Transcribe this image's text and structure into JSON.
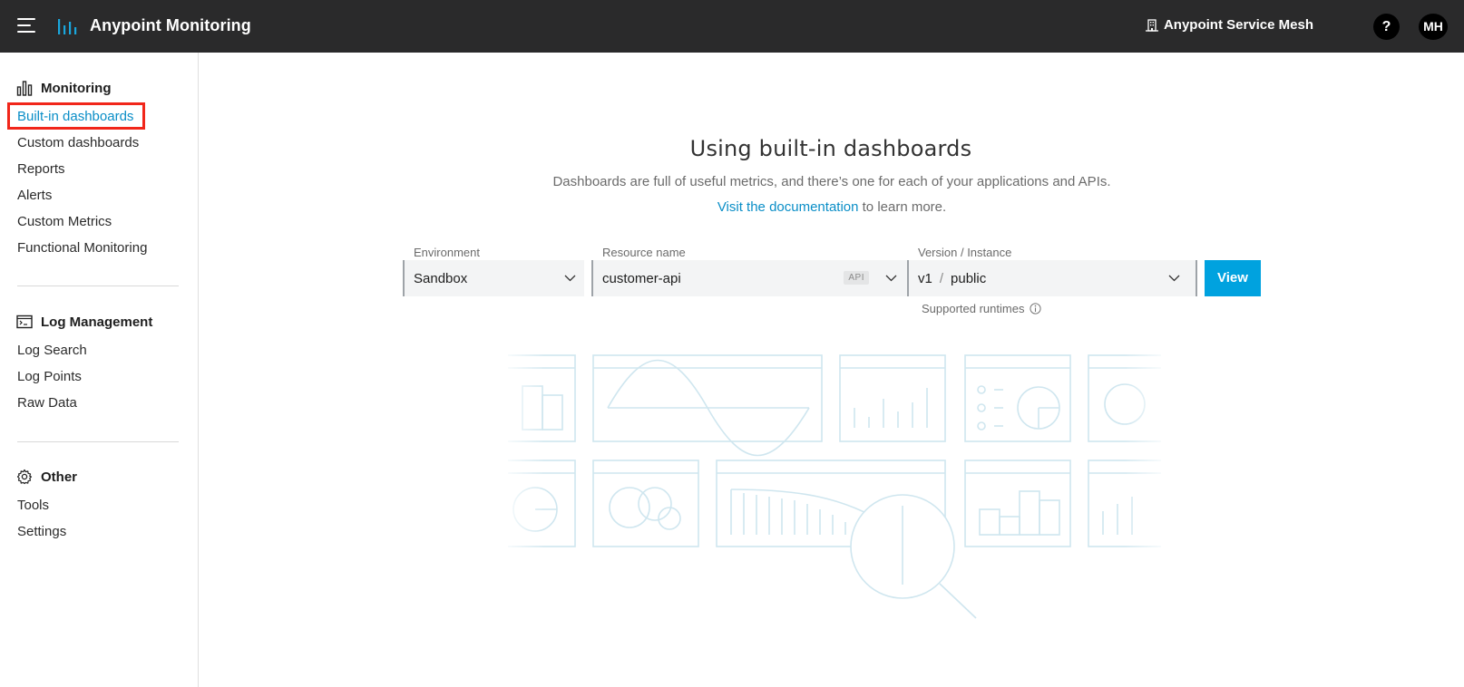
{
  "topbar": {
    "app_title": "Anypoint Monitoring",
    "mesh_label": "Anypoint Service Mesh",
    "help_label": "?",
    "avatar_initials": "MH",
    "menu_icon": "hamburger-menu-icon",
    "logo_icon": "bar-chart-logo-icon",
    "mesh_icon": "building-icon"
  },
  "sidebar": {
    "sections": [
      {
        "title": "Monitoring",
        "icon": "bar-chart-icon",
        "items": [
          "Built-in dashboards",
          "Custom dashboards",
          "Reports",
          "Alerts",
          "Custom Metrics",
          "Functional Monitoring"
        ]
      },
      {
        "title": "Log Management",
        "icon": "terminal-icon",
        "items": [
          "Log Search",
          "Log Points",
          "Raw Data"
        ]
      },
      {
        "title": "Other",
        "icon": "gear-icon",
        "items": [
          "Tools",
          "Settings"
        ]
      }
    ],
    "active_item": "Built-in dashboards"
  },
  "main": {
    "title": "Using built-in dashboards",
    "description": "Dashboards are full of useful metrics, and there’s one for each of your applications and APIs.",
    "doc_link": "Visit the documentation",
    "doc_suffix": " to learn more.",
    "environment": {
      "label": "Environment",
      "value": "Sandbox"
    },
    "resource": {
      "label": "Resource name",
      "value": "customer-api",
      "badge": "API"
    },
    "version": {
      "label": "Version / Instance",
      "version": "v1",
      "separator": "/",
      "instance": "public"
    },
    "view_button": "View",
    "supported_runtimes": "Supported runtimes"
  },
  "colors": {
    "topbar_bg": "#2a2a2b",
    "accent": "#00a2df",
    "link": "#0a8ec7",
    "highlight_box": "#f1261a",
    "illustration": "#cfe6ef"
  }
}
